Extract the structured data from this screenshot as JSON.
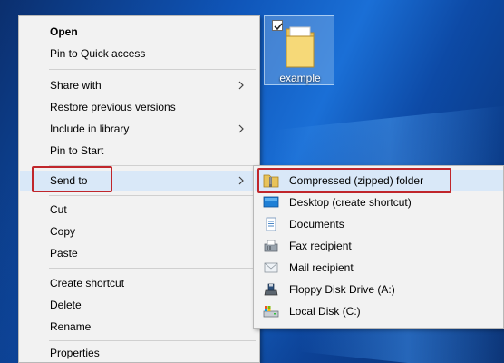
{
  "desktop": {
    "icon_label": "example",
    "icon": "folder-icon",
    "icon_checked": true
  },
  "context_menu": {
    "items": [
      {
        "label": "Open"
      },
      {
        "label": "Pin to Quick access"
      },
      {
        "label": "Share with",
        "submenu": true
      },
      {
        "label": "Restore previous versions"
      },
      {
        "label": "Include in library",
        "submenu": true
      },
      {
        "label": "Pin to Start"
      },
      {
        "label": "Send to",
        "submenu": true,
        "highlighted": true
      },
      {
        "label": "Cut"
      },
      {
        "label": "Copy"
      },
      {
        "label": "Paste"
      },
      {
        "label": "Create shortcut"
      },
      {
        "label": "Delete"
      },
      {
        "label": "Rename"
      },
      {
        "label": "Properties"
      }
    ]
  },
  "send_to_menu": {
    "items": [
      {
        "label": "Compressed (zipped) folder",
        "icon": "zip-folder-icon",
        "highlighted": true
      },
      {
        "label": "Desktop (create shortcut)",
        "icon": "desktop-icon"
      },
      {
        "label": "Documents",
        "icon": "documents-icon"
      },
      {
        "label": "Fax recipient",
        "icon": "fax-icon"
      },
      {
        "label": "Mail recipient",
        "icon": "mail-icon"
      },
      {
        "label": "Floppy Disk Drive (A:)",
        "icon": "floppy-drive-icon"
      },
      {
        "label": "Local Disk (C:)",
        "icon": "local-disk-icon"
      }
    ]
  },
  "colors": {
    "highlight": "#d9e8f8",
    "annotation_box": "#c0262b",
    "menu_background": "#f2f2f2"
  }
}
